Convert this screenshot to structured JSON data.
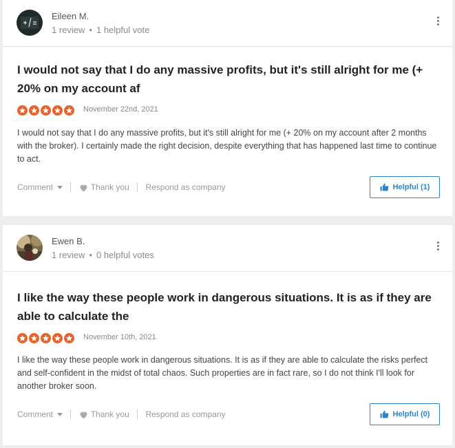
{
  "reviews": [
    {
      "user": {
        "name": "Eileen M.",
        "reviews": "1 review",
        "votes": "1 helpful vote"
      },
      "title": "I would not say that I do any massive profits, but it's still alright for me (+ 20% on my account af",
      "stars": 5,
      "date": "November 22nd, 2021",
      "body": "I would not say that I do any massive profits, but it's still alright for me (+ 20% on my account after 2 months with the broker). I certainly made the right decision, despite everything that has happened last time to continue to act.",
      "actions": {
        "comment": "Comment",
        "thank": "Thank you",
        "respond": "Respond as company"
      },
      "helpful_label": "Helpful (1)"
    },
    {
      "user": {
        "name": "Ewen B.",
        "reviews": "1 review",
        "votes": "0 helpful votes"
      },
      "title": "I like the way these people work in dangerous situations. It is as if they are able to calculate the",
      "stars": 5,
      "date": "November 10th, 2021",
      "body": "I like the way these people work in dangerous situations. It is as if they are able to calculate the risks perfect and self-confident in the midst of total chaos. Such properties are in fact rare, so I do not think I'll look for another broker soon.",
      "actions": {
        "comment": "Comment",
        "thank": "Thank you",
        "respond": "Respond as company"
      },
      "helpful_label": "Helpful (0)"
    }
  ],
  "colors": {
    "star": "#e8632a",
    "accent": "#2e83c6",
    "background": "#ededed"
  }
}
